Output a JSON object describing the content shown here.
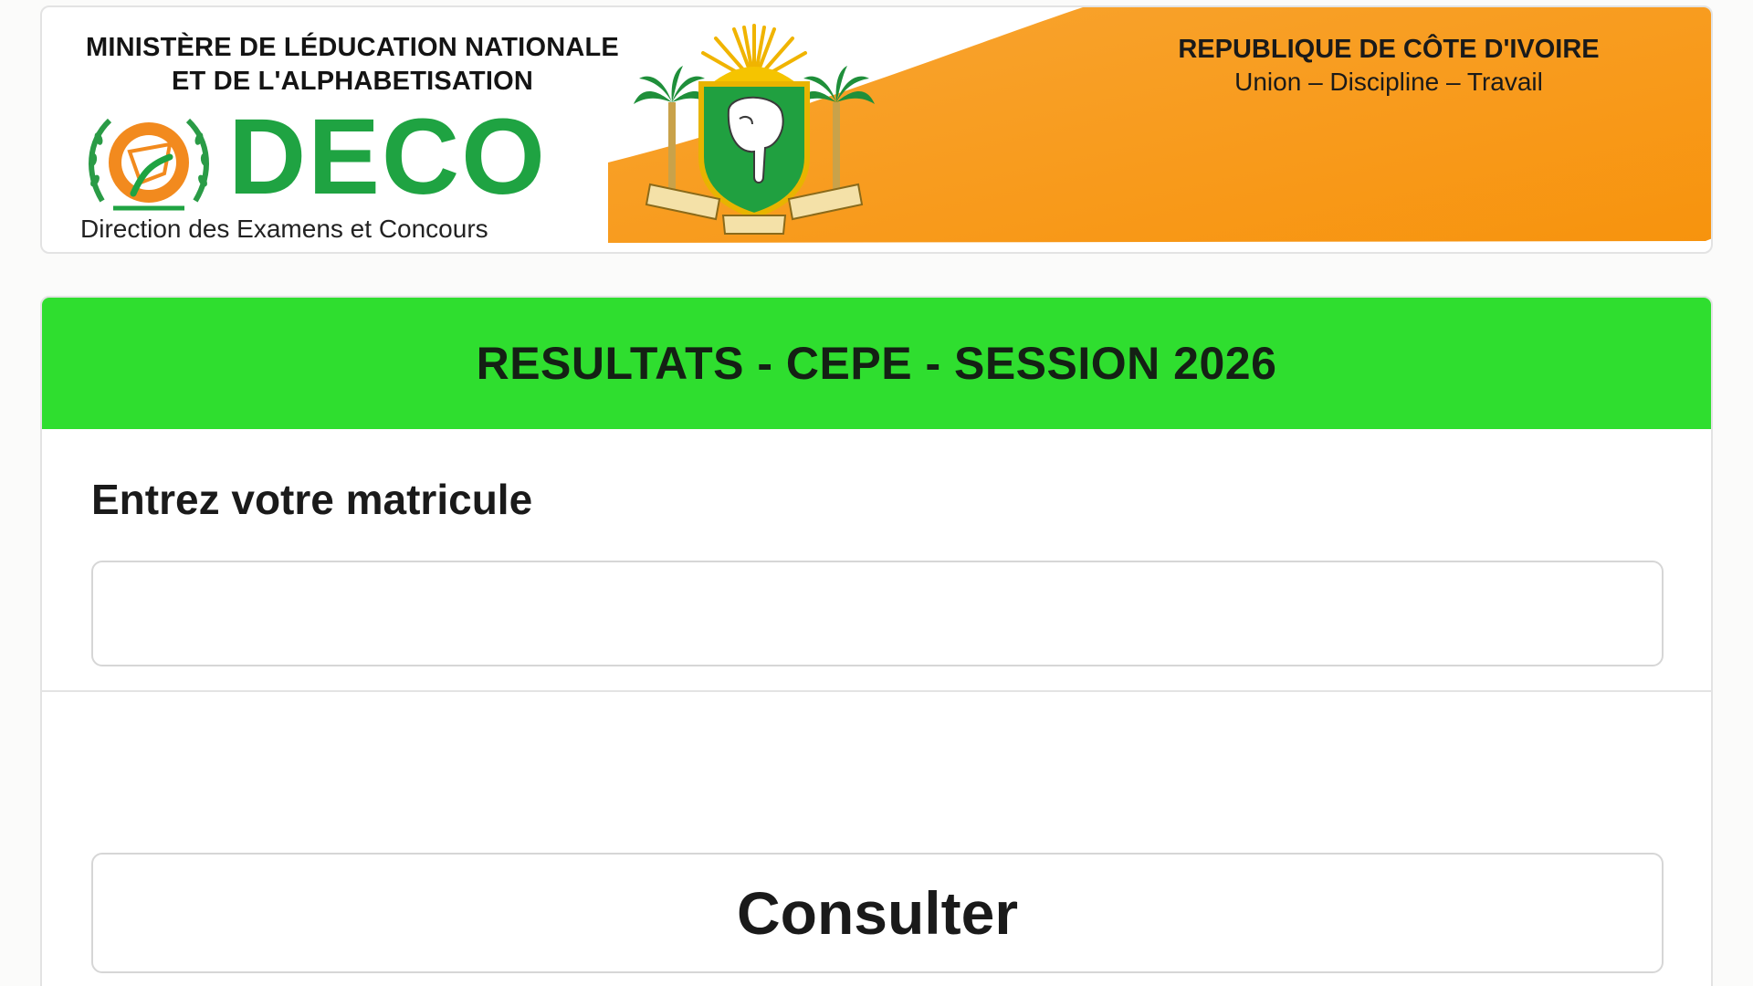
{
  "header": {
    "ministry_line1": "MINISTÈRE DE LÉDUCATION NATIONALE",
    "ministry_line2": "ET DE L'ALPHABETISATION",
    "logo_text": "DECO",
    "logo_subtitle": "Direction des Examens et Concours",
    "republic_name": "REPUBLIQUE DE CÔTE D'IVOIRE",
    "republic_motto": "Union – Discipline – Travail",
    "coat_of_arms_icon": "coat-of-arms-icon",
    "deco_logo_icon": "deco-logo-icon"
  },
  "colors": {
    "orange": "#fa9a1a",
    "green_header": "#2fde2f",
    "logo_green": "#1fa342"
  },
  "results": {
    "title": "RESULTATS - CEPE - SESSION 2026",
    "field_label": "Entrez votre matricule",
    "matricule_value": "",
    "matricule_placeholder": "",
    "submit_label": "Consulter"
  }
}
